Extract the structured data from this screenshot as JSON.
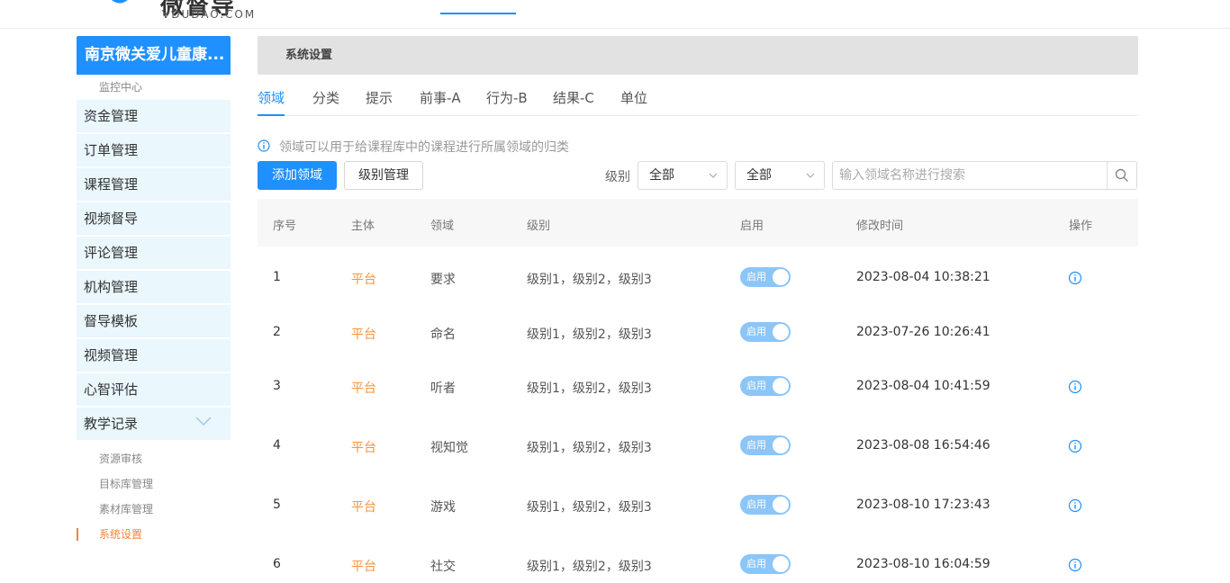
{
  "header": {
    "logo_cn": "微督导",
    "logo_en": "VDUDAO.COM"
  },
  "sidebar": {
    "org_name": "南京微关爱儿童康...",
    "section_label": "监控中心",
    "items": [
      {
        "label": "资金管理"
      },
      {
        "label": "订单管理"
      },
      {
        "label": "课程管理"
      },
      {
        "label": "视频督导"
      },
      {
        "label": "评论管理"
      },
      {
        "label": "机构管理"
      },
      {
        "label": "督导模板"
      },
      {
        "label": "视频管理"
      },
      {
        "label": "心智评估"
      },
      {
        "label": "教学记录"
      }
    ],
    "sub_items": [
      {
        "label": "资源审核"
      },
      {
        "label": "目标库管理"
      },
      {
        "label": "素材库管理"
      },
      {
        "label": "系统设置"
      }
    ]
  },
  "main": {
    "breadcrumb": "系统设置",
    "tabs": [
      {
        "label": "领域"
      },
      {
        "label": "分类"
      },
      {
        "label": "提示"
      },
      {
        "label": "前事-A"
      },
      {
        "label": "行为-B"
      },
      {
        "label": "结果-C"
      },
      {
        "label": "单位"
      }
    ],
    "hint": "领域可以用于给课程库中的课程进行所属领域的归类",
    "add_button": "添加领域",
    "level_button": "级别管理",
    "filter_label": "级别",
    "select1": "全部",
    "select2": "全部",
    "search_placeholder": "输入领域名称进行搜索",
    "table": {
      "headers": [
        "序号",
        "主体",
        "领域",
        "级别",
        "启用",
        "修改时间",
        "操作"
      ],
      "rows": [
        {
          "no": "1",
          "subject": "平台",
          "domain": "要求",
          "level": "级别1，级别2，级别3",
          "enabled": "启用",
          "time": "2023-08-04 10:38:21"
        },
        {
          "no": "2",
          "subject": "平台",
          "domain": "命名",
          "level": "级别1，级别2，级别3",
          "enabled": "启用",
          "time": "2023-07-26 10:26:41"
        },
        {
          "no": "3",
          "subject": "平台",
          "domain": "听者",
          "level": "级别1，级别2，级别3",
          "enabled": "启用",
          "time": "2023-08-04 10:41:59"
        },
        {
          "no": "4",
          "subject": "平台",
          "domain": "视知觉",
          "level": "级别1，级别2，级别3",
          "enabled": "启用",
          "time": "2023-08-08 16:54:46"
        },
        {
          "no": "5",
          "subject": "平台",
          "domain": "游戏",
          "level": "级别1，级别2，级别3",
          "enabled": "启用",
          "time": "2023-08-10 17:23:43"
        },
        {
          "no": "6",
          "subject": "平台",
          "domain": "社交",
          "level": "级别1，级别2，级别3",
          "enabled": "启用",
          "time": "2023-08-10 16:04:59"
        }
      ]
    }
  },
  "colors": {
    "primary": "#1e90ff",
    "accent_orange": "#f5943e",
    "sidebar_bg": "#eaf7fd",
    "toggle_bg": "#8cc5f7"
  }
}
